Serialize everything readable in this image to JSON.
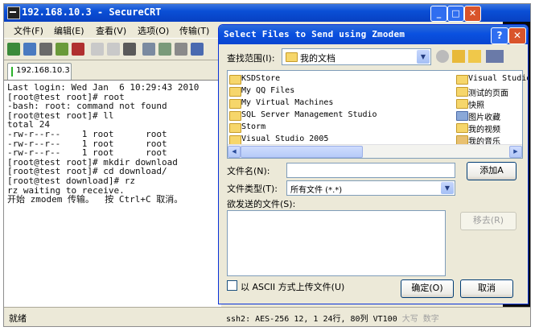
{
  "main_window": {
    "title": "192.168.10.3 - SecureCRT",
    "menu": [
      "文件(F)",
      "编辑(E)",
      "查看(V)",
      "选项(O)",
      "传输(T)"
    ],
    "tab_label": "192.168.10.3",
    "terminal_lines": [
      "Last login: Wed Jan  6 10:29:43 2010",
      "[root@test root]# root",
      "-bash: root: command not found",
      "[root@test root]# ll",
      "total 24",
      "-rw-r--r--    1 root      root",
      "-rw-r--r--    1 root      root",
      "-rw-r--r--    1 root      root",
      "[root@test root]# mkdir download",
      "[root@test root]# cd download/",
      "[root@test download]# rz",
      "rz waiting to receive.",
      "开始 zmodem 传输。  按 Ctrl+C 取消。"
    ],
    "status_left": "就绪",
    "status_right": {
      "ssh": "ssh2: AES-256",
      "pos": "12,   1",
      "size": "24行, 80列",
      "term": "VT100",
      "caps": "大写",
      "num": "数字"
    }
  },
  "dialog": {
    "title": "Select Files to Send using Zmodem",
    "look_in_label": "查找范围(I):",
    "look_in_value": "我的文档",
    "files_left": [
      "KSDStore",
      "My QQ Files",
      "My Virtual Machines",
      "SQL Server Management Studio",
      "Storm",
      "Visual Studio 2005"
    ],
    "files_right": [
      "Visual Studio",
      "测试的页面",
      "快照",
      "图片收藏",
      "我的视频",
      "我的音乐"
    ],
    "filename_label": "文件名(N):",
    "filename_value": "",
    "filetype_label": "文件类型(T):",
    "filetype_value": "所有文件 (*.*)",
    "add_button": "添加A",
    "send_list_label": "欲发送的文件(S):",
    "remove_button": "移去(R)",
    "ascii_label": "以 ASCII 方式上传文件(U)",
    "ok_button": "确定(O)",
    "cancel_button": "取消"
  }
}
